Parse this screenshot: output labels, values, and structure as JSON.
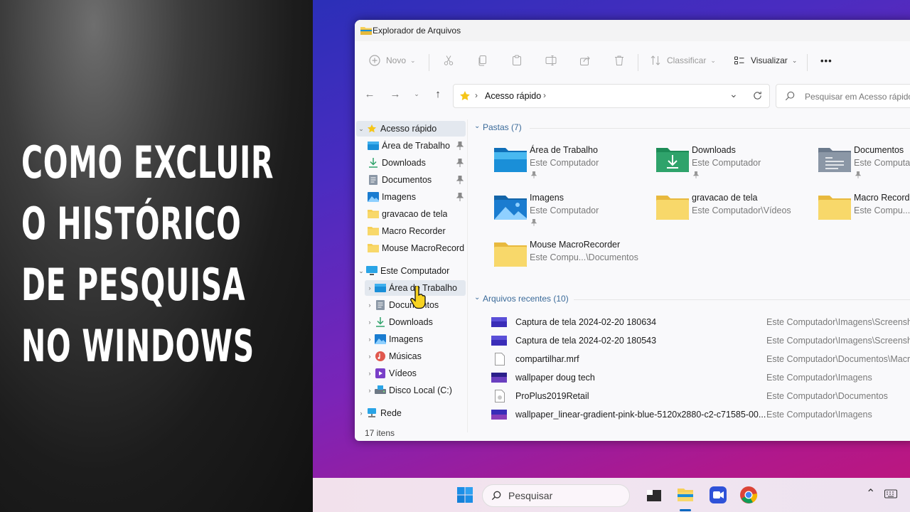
{
  "headline": {
    "lines": [
      "COMO EXCLUIR",
      "O HISTÓRICO",
      "DE PESQUISA",
      "NO WINDOWS"
    ]
  },
  "window": {
    "title": "Explorador de Arquivos"
  },
  "toolbar": {
    "new_label": "Novo",
    "sort_label": "Classificar",
    "view_label": "Visualizar",
    "more_label": "•••"
  },
  "address": {
    "path": "Acesso rápido",
    "search_placeholder": "Pesquisar em Acesso rápido"
  },
  "sidebar": {
    "items": [
      {
        "label": "Acesso rápido"
      },
      {
        "label": "Área de Trabalho"
      },
      {
        "label": "Downloads"
      },
      {
        "label": "Documentos"
      },
      {
        "label": "Imagens"
      },
      {
        "label": "gravacao de tela"
      },
      {
        "label": "Macro Recorder"
      },
      {
        "label": "Mouse MacroRecorder"
      },
      {
        "label": "Este Computador"
      },
      {
        "label": "Área de Trabalho"
      },
      {
        "label": "Documentos"
      },
      {
        "label": "Downloads"
      },
      {
        "label": "Imagens"
      },
      {
        "label": "Músicas"
      },
      {
        "label": "Vídeos"
      },
      {
        "label": "Disco Local (C:)"
      },
      {
        "label": "Rede"
      }
    ]
  },
  "folders": {
    "header": "Pastas (7)",
    "items": [
      {
        "name": "Área de Trabalho",
        "location": "Este Computador"
      },
      {
        "name": "Downloads",
        "location": "Este Computador"
      },
      {
        "name": "Documentos",
        "location": "Este Computador"
      },
      {
        "name": "Imagens",
        "location": "Este Computador"
      },
      {
        "name": "gravacao de tela",
        "location": "Este Computador\\Vídeos"
      },
      {
        "name": "Macro Recorder",
        "location": "Este Compu...\\"
      },
      {
        "name": "Mouse MacroRecorder",
        "location": "Este Compu...\\Documentos"
      }
    ]
  },
  "recent": {
    "header": "Arquivos recentes (10)",
    "items": [
      {
        "name": "Captura de tela 2024-02-20 180634",
        "location": "Este Computador\\Imagens\\Screensho"
      },
      {
        "name": "Captura de tela 2024-02-20 180543",
        "location": "Este Computador\\Imagens\\Screensho"
      },
      {
        "name": "compartilhar.mrf",
        "location": "Este Computador\\Documentos\\Macro"
      },
      {
        "name": "wallpaper doug tech",
        "location": "Este Computador\\Imagens"
      },
      {
        "name": "ProPlus2019Retail",
        "location": "Este Computador\\Documentos"
      },
      {
        "name": "wallpaper_linear-gradient-pink-blue-5120x2880-c2-c71585-00...",
        "location": "Este Computador\\Imagens"
      }
    ]
  },
  "status": {
    "count": "17 itens"
  },
  "taskbar": {
    "search_label": "Pesquisar"
  },
  "colors": {
    "accent": "#0067c0",
    "folder_yellow": "#f6cf57",
    "folder_blue": "#1a8fd8",
    "folder_green": "#2fa36b",
    "selected_bg": "#e3e8ef"
  }
}
